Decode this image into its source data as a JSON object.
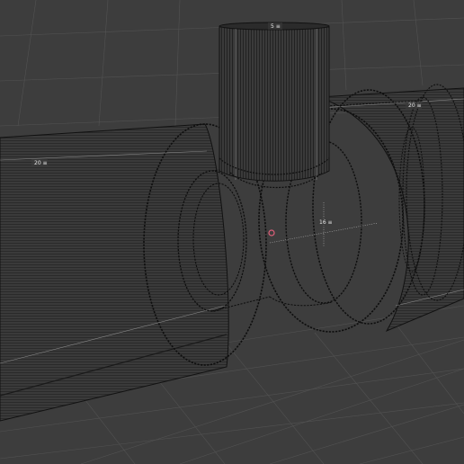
{
  "viewport": {
    "background": "#3d3d3d",
    "grid_color": "#525252",
    "wire_color": "#0e0e0e",
    "edge_highlight": "#9a9a9a",
    "origin_color": "#e0607a"
  },
  "dimensions": {
    "tee_top": "5 ≡",
    "right_pipe": "20 ≡",
    "left_pipe": "20 ≡",
    "center_ring": "16 ≡"
  }
}
